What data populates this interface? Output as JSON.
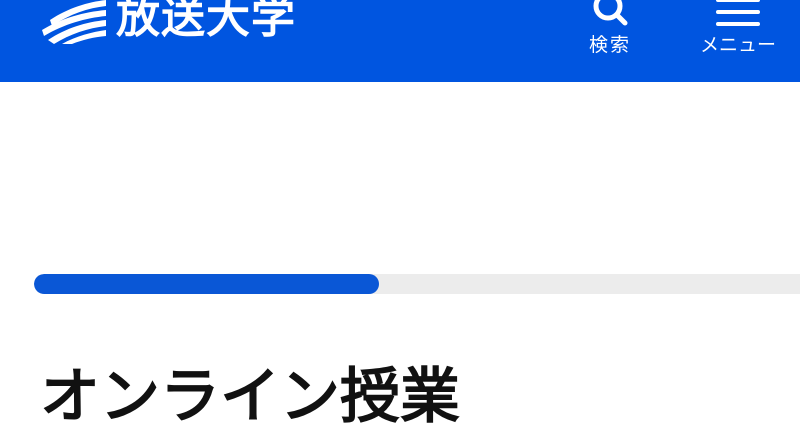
{
  "header": {
    "background_color": "#0055e0",
    "logo_text": "放送大学",
    "search": {
      "icon": "search-icon",
      "label": "検索"
    },
    "menu": {
      "icon": "hamburger-menu-icon",
      "label": "メニュー"
    }
  },
  "progress": {
    "fraction": 0.45,
    "fill_color": "#0a57d6",
    "track_color": "#ececec"
  },
  "main": {
    "title": "オンライン授業"
  }
}
